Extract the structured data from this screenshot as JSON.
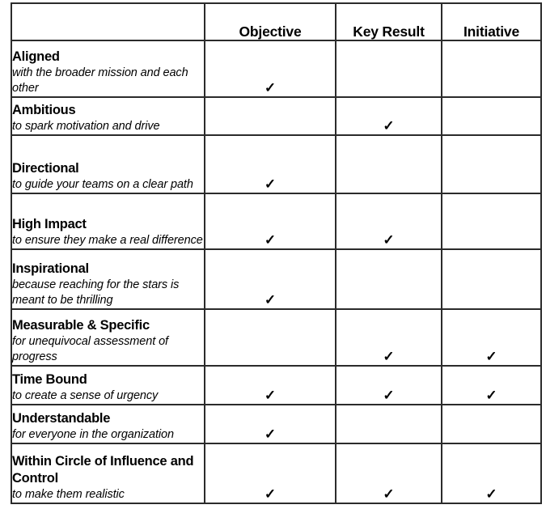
{
  "table": {
    "columns": [
      {
        "key": "criteria",
        "label": ""
      },
      {
        "key": "objective",
        "label": "Objective"
      },
      {
        "key": "key_result",
        "label": "Key Result"
      },
      {
        "key": "initiative",
        "label": "Initiative"
      }
    ],
    "check_glyph": "✓",
    "rows": [
      {
        "title": "Aligned",
        "subtitle": "with the broader mission and each other",
        "objective": "✓",
        "key_result": "",
        "initiative": ""
      },
      {
        "title": "Ambitious",
        "subtitle": "to spark motivation and drive",
        "objective": "",
        "key_result": "✓",
        "initiative": ""
      },
      {
        "title": "Directional",
        "subtitle": "to guide your teams on a clear path",
        "objective": "✓",
        "key_result": "",
        "initiative": ""
      },
      {
        "title": "High Impact",
        "subtitle": "to ensure they make a real difference",
        "objective": "✓",
        "key_result": "✓",
        "initiative": ""
      },
      {
        "title": "Inspirational",
        "subtitle": "because reaching for the stars is meant to be thrilling",
        "objective": "✓",
        "key_result": "",
        "initiative": ""
      },
      {
        "title": "Measurable & Specific",
        "subtitle": "for unequivocal assessment of progress",
        "objective": "",
        "key_result": "✓",
        "initiative": "✓"
      },
      {
        "title": "Time Bound",
        "subtitle": "to create a sense of urgency",
        "objective": "✓",
        "key_result": "✓",
        "initiative": "✓"
      },
      {
        "title": "Understandable",
        "subtitle": "for everyone in the organization",
        "objective": "✓",
        "key_result": "",
        "initiative": ""
      },
      {
        "title": "Within Circle of Influence and Control",
        "subtitle": "to make them realistic",
        "objective": "✓",
        "key_result": "✓",
        "initiative": "✓"
      }
    ]
  },
  "colors": {
    "border": "#2b2b2b",
    "text": "#000000",
    "background": "#ffffff"
  }
}
